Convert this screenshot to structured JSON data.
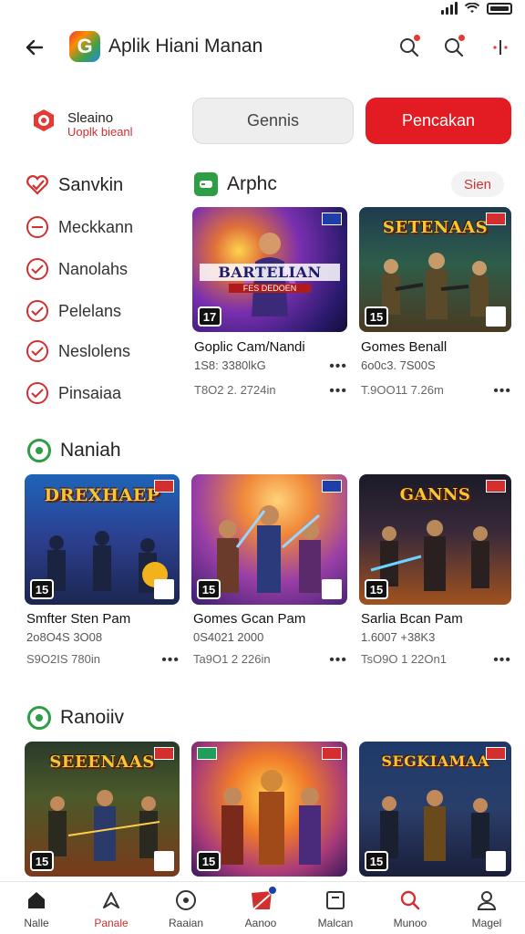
{
  "app": {
    "title": "Aplik Hiani Manan"
  },
  "brand": {
    "name": "Sleaino",
    "subtitle": "Uoplk bieanl"
  },
  "segments": [
    {
      "label": "Gennis"
    },
    {
      "label": "Pencakan"
    }
  ],
  "sidebar": {
    "heading": "Sanvkin",
    "items": [
      {
        "label": "Meckkann"
      },
      {
        "label": "Nanolahs"
      },
      {
        "label": "Pelelans"
      },
      {
        "label": "Neslolens"
      },
      {
        "label": "Pinsaiaa"
      }
    ]
  },
  "sections": [
    {
      "title": "Arphc",
      "see_all": "Sien",
      "cards": [
        {
          "thumb_title": "BARTELIAN",
          "thumb_sub": "FES DEDOEN",
          "age": "17",
          "name": "Goplic Cam/Nandi",
          "meta1": "1S8: 3380lkG",
          "meta2": "T8O2 2. 2724in",
          "more": "•••"
        },
        {
          "thumb_title": "SETENAAS",
          "age": "15",
          "name": "Gomes Benall",
          "meta1": "6o0c3. 7S00S",
          "meta2": "T.9OO11 7.26m",
          "more": "•••"
        }
      ]
    },
    {
      "title": "Naniah",
      "cards": [
        {
          "thumb_title": "DREXHAEP",
          "age": "15",
          "name": "Smfter Sten Pam",
          "meta1": "2o8O4S 3O08",
          "meta2": "S9O2IS 780in",
          "more": "•••"
        },
        {
          "thumb_title": "",
          "age": "15",
          "name": "Gomes Gcan Pam",
          "meta1": "0S4021 2000",
          "meta2": "Ta9O1 2 226in",
          "more": "•••"
        },
        {
          "thumb_title": "GANNS",
          "age": "15",
          "name": "Sarlia Bcan Pam",
          "meta1": "1.6007 +38K3",
          "meta2": "TsO9O 1 22On1",
          "more": "•••"
        }
      ]
    },
    {
      "title": "Ranoiiv",
      "cards": [
        {
          "thumb_title": "SEEENAAS",
          "age": "15",
          "more": ""
        },
        {
          "thumb_title": "",
          "age": "15",
          "more": ""
        },
        {
          "thumb_title": "SEGKIAMAA",
          "age": "15",
          "more": ""
        }
      ]
    }
  ],
  "nav": [
    {
      "label": "Nalle",
      "icon": "home-icon"
    },
    {
      "label": "Panale",
      "icon": "bookmark-icon"
    },
    {
      "label": "Raaian",
      "icon": "search-circle-icon"
    },
    {
      "label": "Aanoo",
      "icon": "news-icon"
    },
    {
      "label": "Malcan",
      "icon": "square-icon"
    },
    {
      "label": "Munoo",
      "icon": "search-icon"
    },
    {
      "label": "Magel",
      "icon": "user-icon"
    }
  ],
  "colors": {
    "accent": "#e31b23",
    "green": "#2e9e45",
    "badge": "#1e3fa8"
  }
}
